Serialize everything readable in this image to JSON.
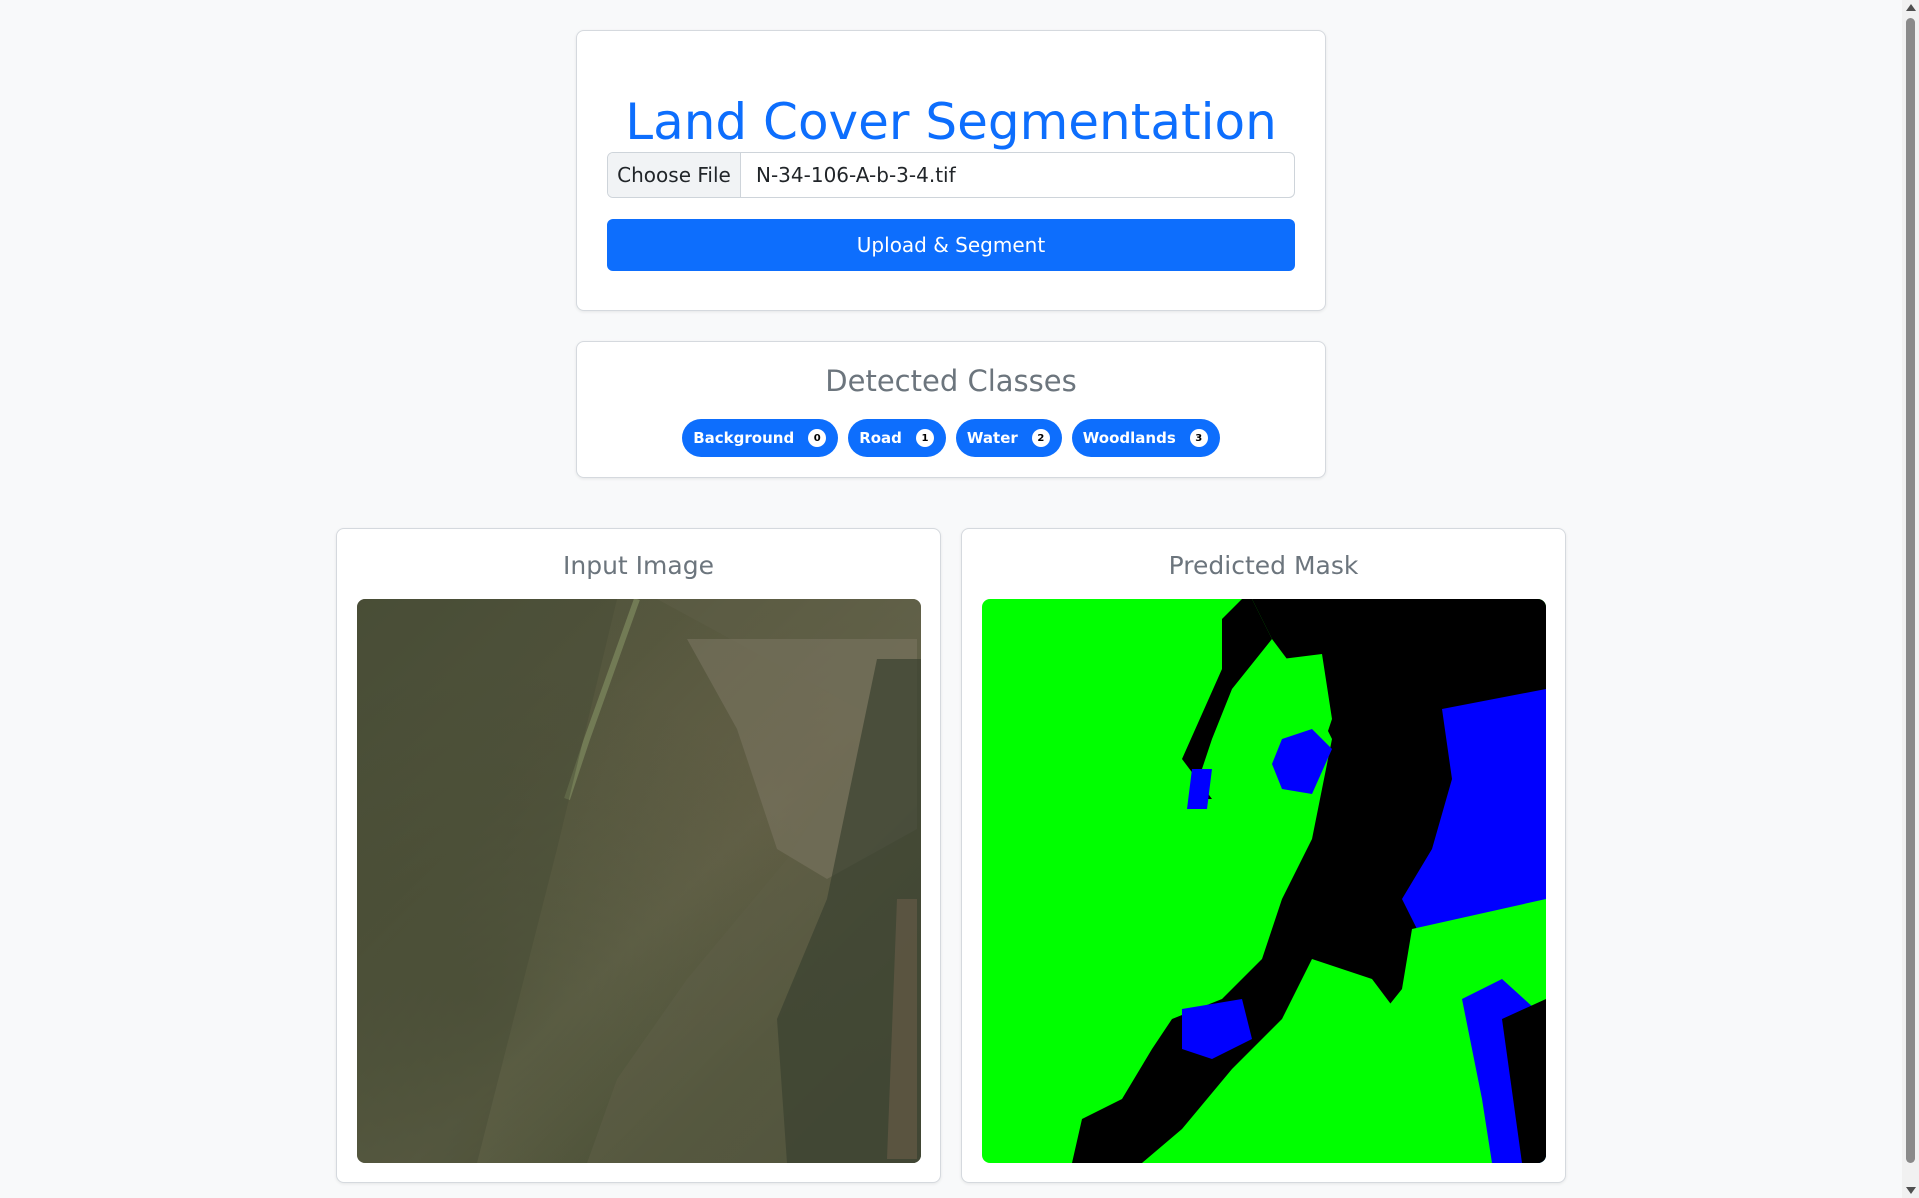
{
  "app": {
    "title": "Land Cover Segmentation"
  },
  "upload": {
    "choose_file_label": "Choose File",
    "file_name": "N-34-106-A-b-3-4.tif",
    "submit_label": "Upload & Segment"
  },
  "classes": {
    "title": "Detected Classes",
    "items": [
      {
        "label": "Background",
        "count": "0"
      },
      {
        "label": "Road",
        "count": "1"
      },
      {
        "label": "Water",
        "count": "2"
      },
      {
        "label": "Woodlands",
        "count": "3"
      }
    ]
  },
  "panels": {
    "input_title": "Input Image",
    "mask_title": "Predicted Mask"
  },
  "colors": {
    "primary": "#0d6efd",
    "mask_woodlands": "#00ff00",
    "mask_water": "#0000ff",
    "mask_background": "#000000"
  }
}
